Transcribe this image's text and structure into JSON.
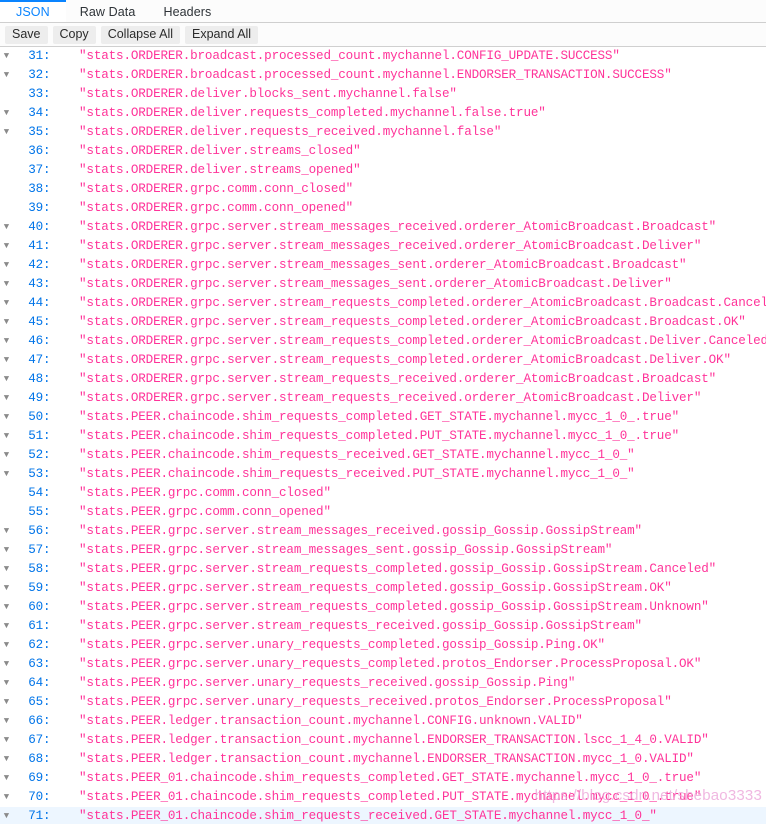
{
  "tabs": [
    {
      "label": "JSON",
      "active": true
    },
    {
      "label": "Raw Data",
      "active": false
    },
    {
      "label": "Headers",
      "active": false
    }
  ],
  "toolbar": {
    "save_label": "Save",
    "copy_label": "Copy",
    "collapse_all_label": "Collapse All",
    "expand_all_label": "Expand All"
  },
  "colors": {
    "accent": "#0a84ff",
    "row_number": "#0074e8",
    "string_value": "#ff3399",
    "selected_row": "#edf6ff",
    "toolbar_button": "#ededed"
  },
  "watermark": "https://blog.csdn.net/shebao3333",
  "json_rows": [
    {
      "index": "31",
      "expandable": true,
      "value": "\"stats.ORDERER.broadcast.processed_count.mychannel.CONFIG_UPDATE.SUCCESS\""
    },
    {
      "index": "32",
      "expandable": true,
      "value": "\"stats.ORDERER.broadcast.processed_count.mychannel.ENDORSER_TRANSACTION.SUCCESS\""
    },
    {
      "index": "33",
      "expandable": false,
      "value": "\"stats.ORDERER.deliver.blocks_sent.mychannel.false\""
    },
    {
      "index": "34",
      "expandable": true,
      "value": "\"stats.ORDERER.deliver.requests_completed.mychannel.false.true\""
    },
    {
      "index": "35",
      "expandable": true,
      "value": "\"stats.ORDERER.deliver.requests_received.mychannel.false\""
    },
    {
      "index": "36",
      "expandable": false,
      "value": "\"stats.ORDERER.deliver.streams_closed\""
    },
    {
      "index": "37",
      "expandable": false,
      "value": "\"stats.ORDERER.deliver.streams_opened\""
    },
    {
      "index": "38",
      "expandable": false,
      "value": "\"stats.ORDERER.grpc.comm.conn_closed\""
    },
    {
      "index": "39",
      "expandable": false,
      "value": "\"stats.ORDERER.grpc.comm.conn_opened\""
    },
    {
      "index": "40",
      "expandable": true,
      "value": "\"stats.ORDERER.grpc.server.stream_messages_received.orderer_AtomicBroadcast.Broadcast\""
    },
    {
      "index": "41",
      "expandable": true,
      "value": "\"stats.ORDERER.grpc.server.stream_messages_received.orderer_AtomicBroadcast.Deliver\""
    },
    {
      "index": "42",
      "expandable": true,
      "value": "\"stats.ORDERER.grpc.server.stream_messages_sent.orderer_AtomicBroadcast.Broadcast\""
    },
    {
      "index": "43",
      "expandable": true,
      "value": "\"stats.ORDERER.grpc.server.stream_messages_sent.orderer_AtomicBroadcast.Deliver\""
    },
    {
      "index": "44",
      "expandable": true,
      "value": "\"stats.ORDERER.grpc.server.stream_requests_completed.orderer_AtomicBroadcast.Broadcast.Canceled\""
    },
    {
      "index": "45",
      "expandable": true,
      "value": "\"stats.ORDERER.grpc.server.stream_requests_completed.orderer_AtomicBroadcast.Broadcast.OK\""
    },
    {
      "index": "46",
      "expandable": true,
      "value": "\"stats.ORDERER.grpc.server.stream_requests_completed.orderer_AtomicBroadcast.Deliver.Canceled\""
    },
    {
      "index": "47",
      "expandable": true,
      "value": "\"stats.ORDERER.grpc.server.stream_requests_completed.orderer_AtomicBroadcast.Deliver.OK\""
    },
    {
      "index": "48",
      "expandable": true,
      "value": "\"stats.ORDERER.grpc.server.stream_requests_received.orderer_AtomicBroadcast.Broadcast\""
    },
    {
      "index": "49",
      "expandable": true,
      "value": "\"stats.ORDERER.grpc.server.stream_requests_received.orderer_AtomicBroadcast.Deliver\""
    },
    {
      "index": "50",
      "expandable": true,
      "value": "\"stats.PEER.chaincode.shim_requests_completed.GET_STATE.mychannel.mycc_1_0_.true\""
    },
    {
      "index": "51",
      "expandable": true,
      "value": "\"stats.PEER.chaincode.shim_requests_completed.PUT_STATE.mychannel.mycc_1_0_.true\""
    },
    {
      "index": "52",
      "expandable": true,
      "value": "\"stats.PEER.chaincode.shim_requests_received.GET_STATE.mychannel.mycc_1_0_\""
    },
    {
      "index": "53",
      "expandable": true,
      "value": "\"stats.PEER.chaincode.shim_requests_received.PUT_STATE.mychannel.mycc_1_0_\""
    },
    {
      "index": "54",
      "expandable": false,
      "value": "\"stats.PEER.grpc.comm.conn_closed\""
    },
    {
      "index": "55",
      "expandable": false,
      "value": "\"stats.PEER.grpc.comm.conn_opened\""
    },
    {
      "index": "56",
      "expandable": true,
      "value": "\"stats.PEER.grpc.server.stream_messages_received.gossip_Gossip.GossipStream\""
    },
    {
      "index": "57",
      "expandable": true,
      "value": "\"stats.PEER.grpc.server.stream_messages_sent.gossip_Gossip.GossipStream\""
    },
    {
      "index": "58",
      "expandable": true,
      "value": "\"stats.PEER.grpc.server.stream_requests_completed.gossip_Gossip.GossipStream.Canceled\""
    },
    {
      "index": "59",
      "expandable": true,
      "value": "\"stats.PEER.grpc.server.stream_requests_completed.gossip_Gossip.GossipStream.OK\""
    },
    {
      "index": "60",
      "expandable": true,
      "value": "\"stats.PEER.grpc.server.stream_requests_completed.gossip_Gossip.GossipStream.Unknown\""
    },
    {
      "index": "61",
      "expandable": true,
      "value": "\"stats.PEER.grpc.server.stream_requests_received.gossip_Gossip.GossipStream\""
    },
    {
      "index": "62",
      "expandable": true,
      "value": "\"stats.PEER.grpc.server.unary_requests_completed.gossip_Gossip.Ping.OK\""
    },
    {
      "index": "63",
      "expandable": true,
      "value": "\"stats.PEER.grpc.server.unary_requests_completed.protos_Endorser.ProcessProposal.OK\""
    },
    {
      "index": "64",
      "expandable": true,
      "value": "\"stats.PEER.grpc.server.unary_requests_received.gossip_Gossip.Ping\""
    },
    {
      "index": "65",
      "expandable": true,
      "value": "\"stats.PEER.grpc.server.unary_requests_received.protos_Endorser.ProcessProposal\""
    },
    {
      "index": "66",
      "expandable": true,
      "value": "\"stats.PEER.ledger.transaction_count.mychannel.CONFIG.unknown.VALID\""
    },
    {
      "index": "67",
      "expandable": true,
      "value": "\"stats.PEER.ledger.transaction_count.mychannel.ENDORSER_TRANSACTION.lscc_1_4_0.VALID\""
    },
    {
      "index": "68",
      "expandable": true,
      "value": "\"stats.PEER.ledger.transaction_count.mychannel.ENDORSER_TRANSACTION.mycc_1_0.VALID\""
    },
    {
      "index": "69",
      "expandable": true,
      "value": "\"stats.PEER_01.chaincode.shim_requests_completed.GET_STATE.mychannel.mycc_1_0_.true\""
    },
    {
      "index": "70",
      "expandable": true,
      "value": "\"stats.PEER_01.chaincode.shim_requests_completed.PUT_STATE.mychannel.mycc_1_0_.true\""
    },
    {
      "index": "71",
      "expandable": true,
      "selected": true,
      "value": "\"stats.PEER_01.chaincode.shim_requests_received.GET_STATE.mychannel.mycc_1_0_\""
    }
  ]
}
